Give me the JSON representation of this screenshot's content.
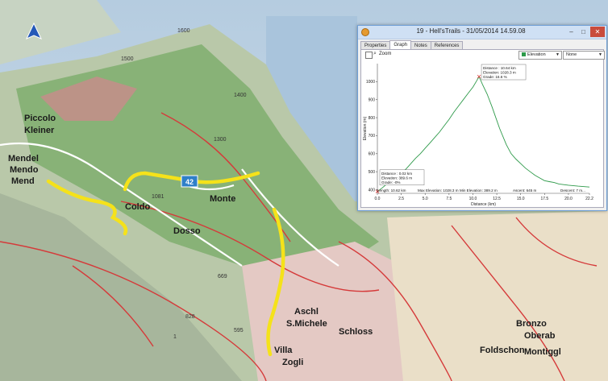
{
  "window": {
    "title": "19 - Hell'sTrails - 31/05/2014 14.59.08",
    "minimize": "–",
    "maximize": "□",
    "close": "✕"
  },
  "tabs": [
    "Properties",
    "Graph",
    "Notes",
    "References"
  ],
  "toolbar": {
    "zoom_label": "Zoom",
    "series_select": "Elevation",
    "second_select": "None",
    "series_color": "#2e9a4a"
  },
  "map": {
    "labels": [
      "Mendel",
      "Mendo",
      "Mend",
      "Piccolo",
      "Kleiner",
      "Coldo",
      "Dosso",
      "Monte",
      "S.Michele",
      "Aschl",
      "Villa",
      "Zogli",
      "Bronzo",
      "Montiggl",
      "Oberab",
      "Foldschon",
      "Schloss"
    ],
    "route_number": "42",
    "numbers": [
      "1500",
      "1081",
      "1400",
      "1300",
      "1600",
      "828",
      "595",
      "669",
      "1"
    ],
    "colors": {
      "route": "#f5e21a",
      "roads": "#d53a3a",
      "forest": "#7fae6e",
      "terrain": "#b9c8a9",
      "lake": "#a9c4dc"
    }
  },
  "chart_data": {
    "type": "line",
    "xlabel": "Distance  (km)",
    "ylabel": "Elevation (m)",
    "xlim": [
      0,
      22.2
    ],
    "ylim": [
      380,
      1100
    ],
    "xticks": [
      "0.0",
      "2.5",
      "5.0",
      "7.5",
      "10.0",
      "12.5",
      "15.0",
      "17.5",
      "20.0",
      "22.2"
    ],
    "yticks": [
      "400",
      "500",
      "600",
      "700",
      "800",
      "900",
      "1000"
    ],
    "grid": false,
    "series": [
      {
        "color": "#2e9a4a",
        "x": [
          0,
          0.5,
          1,
          1.5,
          2,
          2.5,
          3,
          3.5,
          4,
          4.5,
          5,
          5.5,
          6,
          6.5,
          7,
          7.5,
          8,
          8.5,
          9,
          9.5,
          10,
          10.4,
          10.64,
          11,
          11.5,
          12,
          12.3,
          12.8,
          13.5,
          14,
          14.5,
          15,
          15.5,
          16,
          16.5,
          17,
          17.5,
          18,
          18.5,
          19,
          20,
          21,
          22.2
        ],
        "y": [
          390,
          410,
          432,
          455,
          475,
          495,
          515,
          545,
          575,
          600,
          630,
          660,
          690,
          720,
          755,
          790,
          830,
          865,
          900,
          935,
          970,
          1005,
          1028,
          985,
          930,
          860,
          815,
          740,
          650,
          600,
          570,
          545,
          520,
          500,
          480,
          465,
          450,
          445,
          440,
          432,
          425,
          420,
          415
        ]
      }
    ],
    "annotations": [
      {
        "lines": [
          "Distance : 10.64 km",
          "Elevation: 1028.3 m",
          "Grade: 16.6 %"
        ]
      },
      {
        "lines": [
          "Distance : 0.02 km",
          "Elevation: 389.6 m",
          "Grade: -0%"
        ]
      }
    ],
    "footer": [
      "Length: 10.62 km",
      "Max Elevation: 1028.3 m",
      "Min Elevation: 389.2 m",
      "Ascent: 645 m",
      "Descent: 7 m..."
    ]
  }
}
